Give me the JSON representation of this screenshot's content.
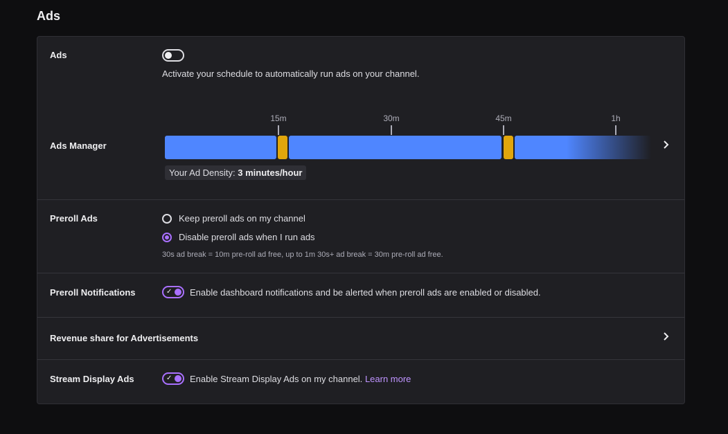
{
  "page": {
    "title": "Ads"
  },
  "ads": {
    "label": "Ads",
    "toggle_on": false,
    "description": "Activate your schedule to automatically run ads on your channel."
  },
  "ads_manager": {
    "label": "Ads Manager",
    "ticks": [
      "15m",
      "30m",
      "45m",
      "1h"
    ],
    "density_prefix": "Your Ad Density:",
    "density_value": "3 minutes/hour"
  },
  "preroll": {
    "label": "Preroll Ads",
    "options": [
      {
        "label": "Keep preroll ads on my channel",
        "checked": false
      },
      {
        "label": "Disable preroll ads when I run ads",
        "checked": true
      }
    ],
    "note": "30s ad break = 10m pre-roll ad free, up to 1m 30s+ ad break = 30m pre-roll ad free."
  },
  "preroll_notifications": {
    "label": "Preroll Notifications",
    "toggle_on": true,
    "description": "Enable dashboard notifications and be alerted when preroll ads are enabled or disabled."
  },
  "revenue_share": {
    "label": "Revenue share for Advertisements"
  },
  "stream_display": {
    "label": "Stream Display Ads",
    "toggle_on": true,
    "description": "Enable Stream Display Ads on my channel.",
    "link": "Learn more"
  },
  "colors": {
    "accent": "#a970ff",
    "bar_blue": "#4f86ff",
    "bar_ad": "#e1a60c"
  },
  "icons": {
    "chevron": "chevron-right-icon",
    "check": "checkmark-icon"
  }
}
